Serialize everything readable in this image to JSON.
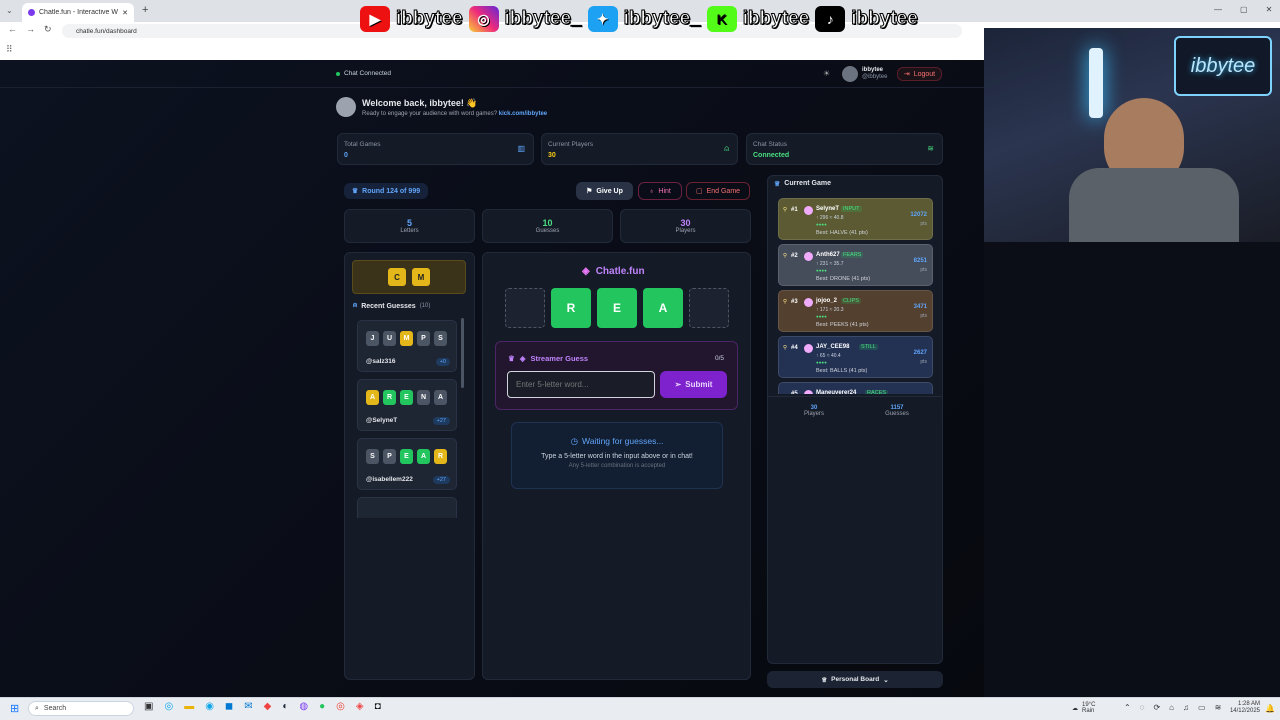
{
  "browser": {
    "tab_title": "Chatle.fun - Interactive Wordle",
    "url": "chatle.fun/dashboard"
  },
  "overlay": {
    "handles": [
      "ibbytee",
      "ibbytee_",
      "ibbytee_",
      "ibbytee",
      "ibbytee"
    ],
    "webcam_logo": "ibbytee"
  },
  "header": {
    "chat_status": "Chat Connected",
    "user_name": "ibbytee",
    "user_handle": "@ibbytee",
    "logout_label": "Logout"
  },
  "welcome": {
    "title": "Welcome back, ibbytee! 👋",
    "subtitle": "Ready to engage your audience with word games?",
    "link": "kick.com/ibbytee"
  },
  "stats": [
    {
      "label": "Total Games",
      "value": "0",
      "color": "#60a5fa"
    },
    {
      "label": "Current Players",
      "value": "30",
      "color": "#facc15"
    },
    {
      "label": "Chat Status",
      "value": "Connected",
      "color": "#4ade80"
    }
  ],
  "round": {
    "label": "Round 124 of 999"
  },
  "actions": {
    "give_up": "Give Up",
    "hint": "Hint",
    "end_game": "End Game"
  },
  "game_info": [
    {
      "value": "5",
      "label": "Letters",
      "color": "#60a5fa"
    },
    {
      "value": "10",
      "label": "Guesses",
      "color": "#4ade80"
    },
    {
      "value": "30",
      "label": "Players",
      "color": "#c084fc"
    }
  ],
  "hint_letters": [
    "C",
    "M"
  ],
  "recent": {
    "title": "Recent Guesses",
    "count": "(10)",
    "items": [
      {
        "letters": [
          "J",
          "U",
          "M",
          "P",
          "S"
        ],
        "colors": [
          "gy",
          "gy",
          "yl",
          "gy",
          "gy"
        ],
        "user": "@salz316",
        "pts": "+0"
      },
      {
        "letters": [
          "A",
          "R",
          "E",
          "N",
          "A"
        ],
        "colors": [
          "yl",
          "gr",
          "gr",
          "gy",
          "gy"
        ],
        "user": "@SelyneT",
        "pts": "+27"
      },
      {
        "letters": [
          "S",
          "P",
          "E",
          "A",
          "R"
        ],
        "colors": [
          "gy",
          "gy",
          "gr",
          "gr",
          "yl"
        ],
        "user": "@isabellem222",
        "pts": "+27"
      }
    ]
  },
  "board": {
    "brand": "Chatle.fun",
    "slots": [
      "",
      "R",
      "E",
      "A",
      ""
    ]
  },
  "streamer": {
    "title": "Streamer Guess",
    "count": "0/5",
    "placeholder": "Enter 5-letter word...",
    "submit": "Submit"
  },
  "waiting": {
    "title": "Waiting for guesses...",
    "line1": "Type a 5-letter word in the input above or in chat!",
    "line2": "Any 5-letter combination is accepted"
  },
  "leaderboard": {
    "title": "Current Game",
    "entries": [
      {
        "rank": "#1",
        "name": "SelyneT",
        "tag": "INPUT",
        "stats": "↑ 296 ≈ 40.8",
        "best": "Best: HALVE (41 pts)",
        "pts": "12072",
        "bg": "#5b5a33"
      },
      {
        "rank": "#2",
        "name": "Anth627",
        "tag": "FEARS",
        "stats": "↑ 231 ≈ 35.7",
        "best": "Best: DRONE (41 pts)",
        "pts": "8251",
        "bg": "#454c5a"
      },
      {
        "rank": "#3",
        "name": "jojoo_2",
        "tag": "CLIPS",
        "stats": "↑ 171 ≈ 20.3",
        "best": "Best: PEEKS (41 pts)",
        "pts": "3471",
        "bg": "#54402f"
      },
      {
        "rank": "#4",
        "name": "JAY_CEE98",
        "tag": "STILL",
        "stats": "↑ 65 ≈ 40.4",
        "best": "Best: BALLS (41 pts)",
        "pts": "2627",
        "bg": "#233153"
      },
      {
        "rank": "#5",
        "name": "Maneuverer24",
        "tag": "RACES",
        "stats": "",
        "best": "",
        "pts": "",
        "bg": "#233153"
      }
    ],
    "footer_players": "30",
    "footer_players_label": "Players",
    "footer_guesses": "1157",
    "footer_guesses_label": "Guesses",
    "personal_board": "Personal Board"
  },
  "taskbar": {
    "search": "Search",
    "weather_temp": "19°C",
    "weather_desc": "Rain",
    "time": "1:28 AM",
    "date": "14/12/2025"
  }
}
